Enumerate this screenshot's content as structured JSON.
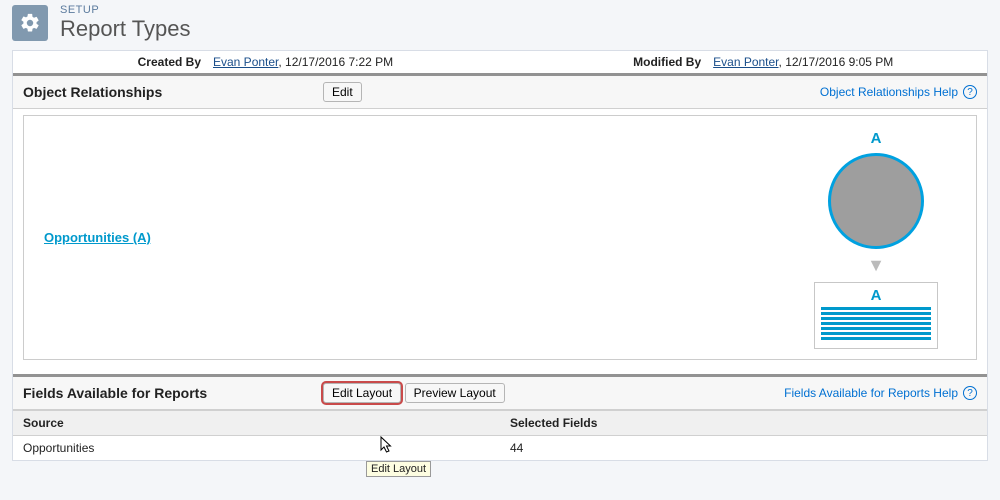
{
  "header": {
    "small_label": "SETUP",
    "title": "Report Types"
  },
  "meta": {
    "created_by_label": "Created By",
    "created_by_name": "Evan Ponter",
    "created_date": ", 12/17/2016 7:22 PM",
    "modified_by_label": "Modified By",
    "modified_by_name": "Evan Ponter",
    "modified_date": ", 12/17/2016 9:05 PM"
  },
  "object_rel": {
    "title": "Object Relationships",
    "edit_label": "Edit",
    "help_label": "Object Relationships Help",
    "link_text": "Opportunities (A)",
    "letter": "A"
  },
  "fields_section": {
    "title": "Fields Available for Reports",
    "edit_layout_label": "Edit Layout",
    "preview_layout_label": "Preview Layout",
    "help_label": "Fields Available for Reports Help",
    "col_source": "Source",
    "col_selected": "Selected Fields",
    "row_source": "Opportunities",
    "row_selected": "44",
    "tooltip_text": "Edit Layout"
  }
}
